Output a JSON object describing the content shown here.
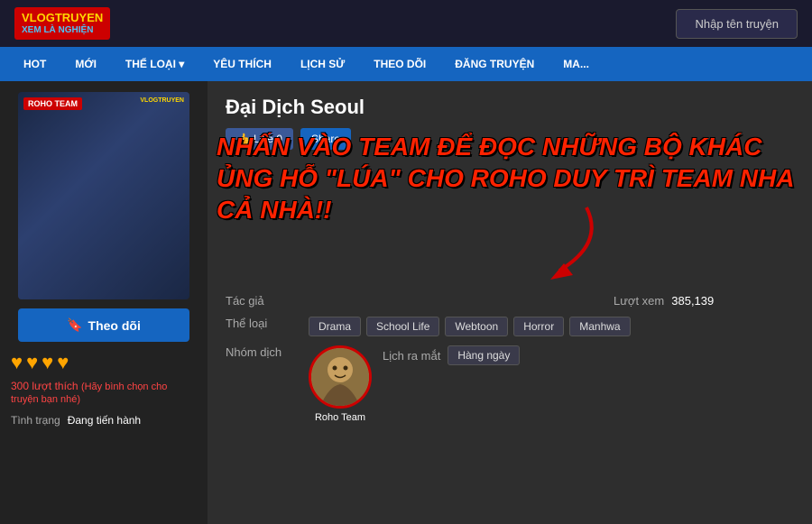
{
  "header": {
    "logo_line1": "VLOGTRUYEN",
    "logo_line2": "XEM LÀ NGHIỆN",
    "search_placeholder": "Nhập tên truyện"
  },
  "nav": {
    "items": [
      {
        "label": "HOT"
      },
      {
        "label": "MỚI"
      },
      {
        "label": "THỂ LOẠI ▾"
      },
      {
        "label": "YÊU THÍCH"
      },
      {
        "label": "LỊCH SỬ"
      },
      {
        "label": "THEO DÕI"
      },
      {
        "label": "ĐĂNG TRUYỆN"
      },
      {
        "label": "MA..."
      }
    ]
  },
  "sidebar": {
    "cover_label": "ROHO TEAM",
    "cover_watermark": "VLOGTRUYEN",
    "follow_label": "Theo dõi",
    "hearts": [
      "♥",
      "♥",
      "♥",
      "♥"
    ],
    "likes_count": "300 lượt thích",
    "likes_note": "(Hãy bình chọn cho truyện bạn nhé)",
    "status_label": "Tình trạng",
    "status_value": "Đang tiến hành"
  },
  "main": {
    "title": "Đại Dịch Seoul",
    "like_label": "Like 0",
    "share_label": "Share",
    "overlay_text": "NHẤN VÀO TEAM ĐỂ ĐỌC NHỮNG BỘ KHÁC ỦNG HỖ \"LÚA\" CHO ROHO DUY TRÌ TEAM NHA CẢ NHÀ!!",
    "author_label": "Tác giả",
    "author_value": "",
    "views_label": "Lượt xem",
    "views_value": "385,139",
    "genre_label": "Thể loại",
    "genres": [
      "Drama",
      "School Life",
      "Webtoon",
      "Horror",
      "Manhwa"
    ],
    "group_label": "Nhóm dịch",
    "group_name": "Roho Team",
    "release_label": "Lịch ra mắt",
    "release_value": "Hàng ngày"
  }
}
